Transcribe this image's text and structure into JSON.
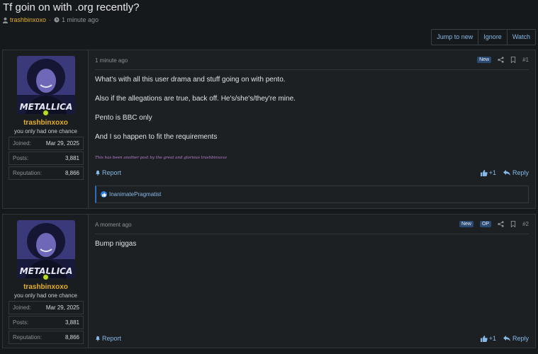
{
  "thread": {
    "title": "Tf goin on with .org recently?",
    "author": "trashbinxoxo",
    "separator": "·",
    "time": "1 minute ago"
  },
  "actions": {
    "jump": "Jump to new",
    "ignore": "Ignore",
    "watch": "Watch"
  },
  "posts": [
    {
      "user": {
        "name": "trashbinxoxo",
        "title": "you only had one chance",
        "joined_label": "Joined:",
        "joined": "Mar 29, 2025",
        "posts_label": "Posts:",
        "posts": "3,881",
        "rep_label": "Reputation:",
        "rep": "8,866",
        "avatar_text": "METALLICA"
      },
      "time": "1 minute ago",
      "badges": [
        "New"
      ],
      "number": "#1",
      "body": [
        "What's with all this user drama and stuff going on with pento.",
        "Also if the allegations are true, back off. He's/she's/they're mine.",
        "Pento is BBC only",
        "And I so happen to fit the requirements"
      ],
      "signature": "This has been another post by the great and glorious trashbinxoxo",
      "report": "Report",
      "react_count": "+1",
      "reply": "Reply",
      "reaction_user": "InanimatePragmatist"
    },
    {
      "user": {
        "name": "trashbinxoxo",
        "title": "you only had one chance",
        "joined_label": "Joined:",
        "joined": "Mar 29, 2025",
        "posts_label": "Posts:",
        "posts": "3,881",
        "rep_label": "Reputation:",
        "rep": "8,866",
        "avatar_text": "METALLICA"
      },
      "time": "A moment ago",
      "badges": [
        "New",
        "OP"
      ],
      "number": "#2",
      "body": [
        "Bump niggas"
      ],
      "report": "Report",
      "react_count": "+1",
      "reply": "Reply"
    }
  ],
  "colors": {
    "background": "#16191c",
    "username": "#e5b028",
    "link": "#86b9e8",
    "signature": "#b77ed4",
    "badge": "#2b4a72",
    "online": "#b5df1e"
  }
}
